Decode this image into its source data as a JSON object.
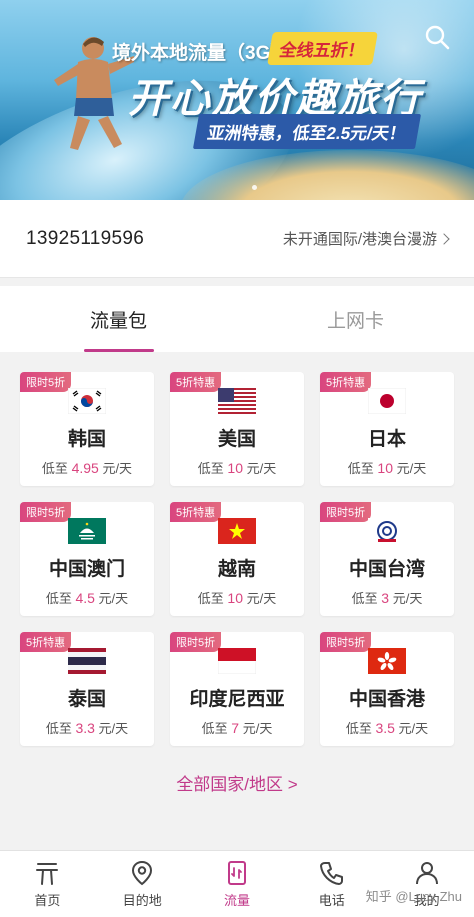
{
  "banner": {
    "headline_small": "境外本地流量（3G）",
    "badge": "全线五折！",
    "headline_big": "开心放价趣旅行",
    "sub_offer": "亚洲特惠，低至2.5元/天！",
    "search_icon": "search-icon"
  },
  "account": {
    "phone": "13925119596",
    "roaming_status": "未开通国际/港澳台漫游"
  },
  "tabs": [
    {
      "label": "流量包",
      "active": true
    },
    {
      "label": "上网卡",
      "active": false
    }
  ],
  "packages": [
    {
      "tag": "限时5折",
      "flag": "kr",
      "name": "韩国",
      "price_prefix": "低至",
      "price": "4.95",
      "price_suffix": "元/天"
    },
    {
      "tag": "5折特惠",
      "flag": "us",
      "name": "美国",
      "price_prefix": "低至",
      "price": "10",
      "price_suffix": "元/天"
    },
    {
      "tag": "5折特惠",
      "flag": "jp",
      "name": "日本",
      "price_prefix": "低至",
      "price": "10",
      "price_suffix": "元/天"
    },
    {
      "tag": "限时5折",
      "flag": "mo",
      "name": "中国澳门",
      "price_prefix": "低至",
      "price": "4.5",
      "price_suffix": "元/天"
    },
    {
      "tag": "5折特惠",
      "flag": "vn",
      "name": "越南",
      "price_prefix": "低至",
      "price": "10",
      "price_suffix": "元/天"
    },
    {
      "tag": "限时5折",
      "flag": "tw",
      "name": "中国台湾",
      "price_prefix": "低至",
      "price": "3",
      "price_suffix": "元/天"
    },
    {
      "tag": "5折特惠",
      "flag": "th",
      "name": "泰国",
      "price_prefix": "低至",
      "price": "3.3",
      "price_suffix": "元/天"
    },
    {
      "tag": "限时5折",
      "flag": "id",
      "name": "印度尼西亚",
      "price_prefix": "低至",
      "price": "7",
      "price_suffix": "元/天"
    },
    {
      "tag": "限时5折",
      "flag": "hk",
      "name": "中国香港",
      "price_prefix": "低至",
      "price": "3.5",
      "price_suffix": "元/天"
    }
  ],
  "all_countries_link": "全部国家/地区 >",
  "nav": [
    {
      "label": "首页",
      "icon": "home-icon",
      "active": false
    },
    {
      "label": "目的地",
      "icon": "location-pin-icon",
      "active": false
    },
    {
      "label": "流量",
      "icon": "data-icon",
      "active": true
    },
    {
      "label": "电话",
      "icon": "phone-icon",
      "active": false
    },
    {
      "label": "我的",
      "icon": "profile-icon",
      "active": false
    }
  ],
  "watermark": "知乎 @Lucy Zhu",
  "colors": {
    "accent": "#c13a8a",
    "tag": "#d9457f",
    "price": "#d9457f"
  }
}
